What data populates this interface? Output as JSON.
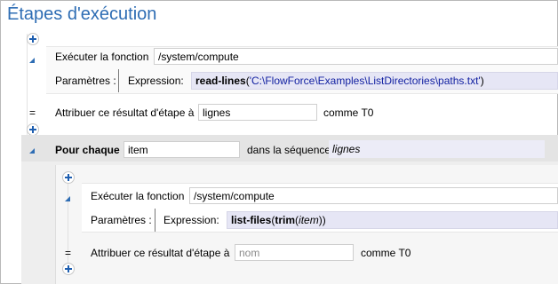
{
  "title": "Étapes d'exécution",
  "step1": {
    "exec_label": "Exécuter la fonction",
    "function_value": "/system/compute",
    "params_label": "Paramètres :",
    "expr_label": "Expression:",
    "expr_func": "read-lines",
    "expr_open": "(",
    "expr_string": "'C:\\FlowForce\\Examples\\ListDirectories\\paths.txt'",
    "expr_close": ")"
  },
  "assign1": {
    "eq": "=",
    "label": "Attribuer ce résultat d'étape à",
    "value": "lignes",
    "suffix": "comme T0"
  },
  "foreach": {
    "label": "Pour chaque",
    "item_value": "item",
    "seq_label": "dans la séquence",
    "seq_value": "lignes"
  },
  "step2": {
    "exec_label": "Exécuter la fonction",
    "function_value": "/system/compute",
    "params_label": "Paramètres :",
    "expr_label": "Expression:",
    "expr_func1": "list-files",
    "expr_open1": "(",
    "expr_func2": "trim",
    "expr_open2": "(",
    "expr_arg": "item",
    "expr_close": "))"
  },
  "assign2": {
    "eq": "=",
    "label": "Attribuer ce résultat d'étape à",
    "placeholder": "nom",
    "suffix": "comme T0"
  },
  "colors": {
    "title": "#2e6db4",
    "plus_icon": "#1f5fb0",
    "loop_bg": "#eeeeee",
    "inner_bg": "#f4f4f4",
    "expr_bg": "#e6e6f5",
    "string": "#0f1ea0"
  }
}
